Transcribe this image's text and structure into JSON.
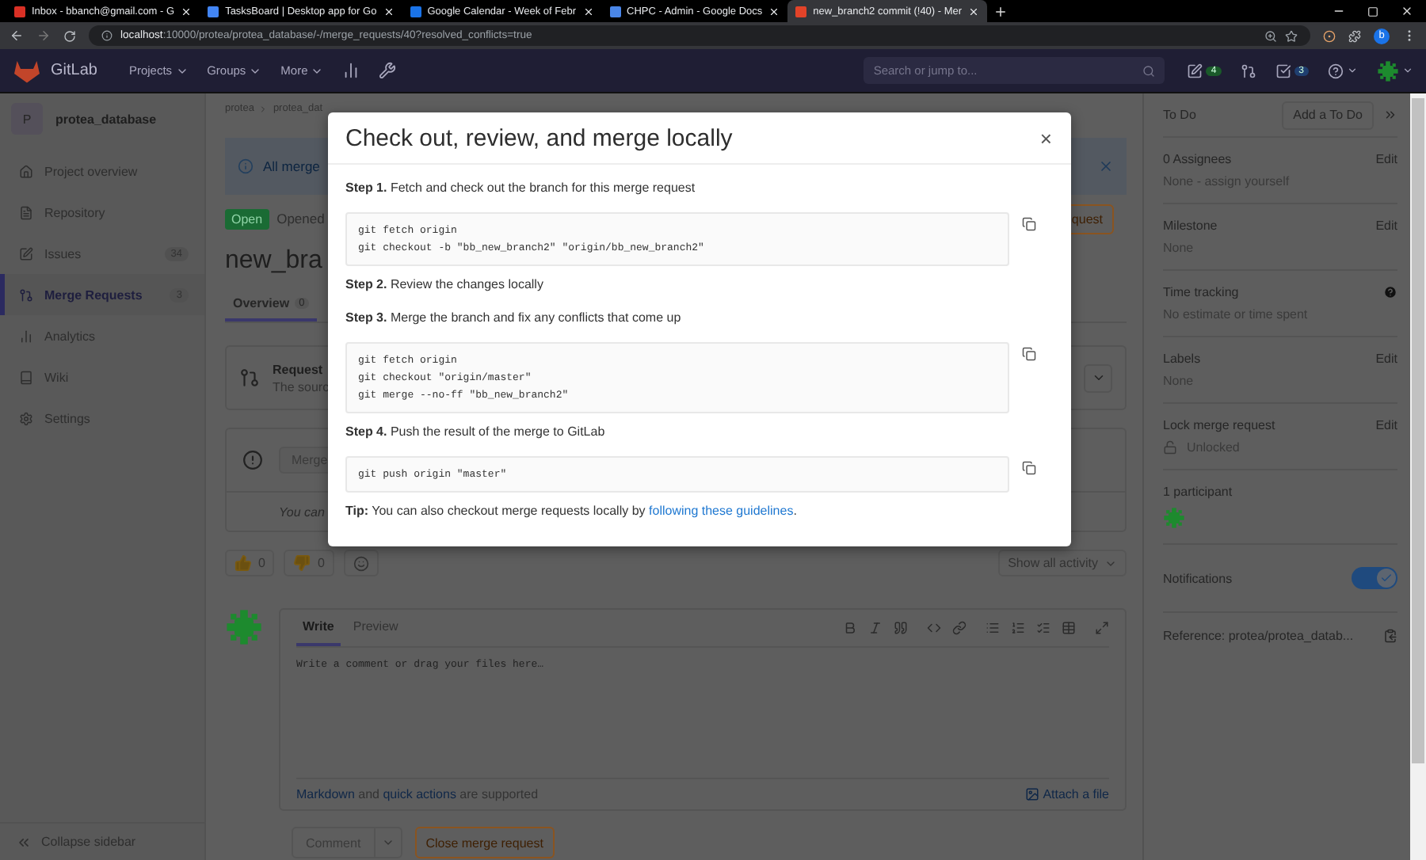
{
  "browser": {
    "tabs": [
      {
        "title": "Inbox - bbanch@gmail.com - G",
        "selected": false
      },
      {
        "title": "TasksBoard | Desktop app for Go",
        "selected": false
      },
      {
        "title": "Google Calendar - Week of Febr",
        "selected": false
      },
      {
        "title": "CHPC - Admin - Google Docs",
        "selected": false
      },
      {
        "title": "new_branch2 commit (!40) - Mer",
        "selected": true
      }
    ],
    "url_host": "localhost",
    "url_rest": ":10000/protea/protea_database/-/merge_requests/40?resolved_conflicts=true",
    "profile_initial": "b"
  },
  "navbar": {
    "brand": "GitLab",
    "menus": [
      "Projects",
      "Groups",
      "More"
    ],
    "search": {
      "placeholder": "Search or jump to..."
    },
    "issues_count": "4",
    "todos_count": "3"
  },
  "sidebar": {
    "project_initial": "P",
    "project_name": "protea_database",
    "items": [
      {
        "label": "Project overview",
        "selected": false
      },
      {
        "label": "Repository",
        "selected": false
      },
      {
        "label": "Issues",
        "count": "34",
        "selected": false
      },
      {
        "label": "Merge Requests",
        "count": "3",
        "selected": true
      },
      {
        "label": "Analytics",
        "selected": false
      },
      {
        "label": "Wiki",
        "selected": false
      },
      {
        "label": "Settings",
        "selected": false
      }
    ],
    "collapse": "Collapse sidebar"
  },
  "breadcrumb": [
    "protea",
    "protea_dat"
  ],
  "alert": {
    "text": "All merge"
  },
  "status": {
    "badge": "Open",
    "text": "Opened"
  },
  "header_button": "quest",
  "title": "new_bra",
  "tabs": [
    {
      "label": "Overview",
      "count": "0",
      "selected": true
    }
  ],
  "request_card": {
    "title": "Request",
    "text": "The sourc"
  },
  "merge_widget": {
    "button": "Merge",
    "note": "You can"
  },
  "reactions": [
    {
      "kind": "thumbs_up",
      "count": "0"
    },
    {
      "kind": "thumbs_down",
      "count": "0"
    }
  ],
  "activity_filter": "Show all activity",
  "editor": {
    "tabs": [
      {
        "label": "Write",
        "selected": true
      },
      {
        "label": "Preview",
        "selected": false
      }
    ],
    "placeholder": "Write a comment or drag your files here…",
    "footer": [
      {
        "text": "Markdown",
        "kind": "link"
      },
      {
        "text": " and ",
        "kind": "text"
      },
      {
        "text": "quick actions",
        "kind": "link"
      },
      {
        "text": " are supported",
        "kind": "text"
      }
    ],
    "attach": "Attach a file"
  },
  "actions": {
    "comment": "Comment",
    "close": "Close merge request"
  },
  "right_sidebar": {
    "todo_label": "To Do",
    "todo_button": "Add a To Do",
    "sections": [
      {
        "title": "0 Assignees",
        "action": "Edit",
        "value": "None - assign yourself"
      },
      {
        "title": "Milestone",
        "action": "Edit",
        "value": "None"
      },
      {
        "title": "Time tracking",
        "help": true,
        "value": "No estimate or time spent"
      },
      {
        "title": "Labels",
        "action": "Edit",
        "value": "None"
      },
      {
        "title": "Lock merge request",
        "action": "Edit",
        "value": "Unlocked",
        "lock": true
      },
      {
        "title": "1 participant",
        "avatar": true
      }
    ],
    "notifications": {
      "label": "Notifications",
      "on": true
    },
    "reference": "Reference: protea/protea_datab..."
  },
  "modal": {
    "title": "Check out, review, and merge locally",
    "close": "×",
    "steps": [
      {
        "text": "**Step 1.** Fetch and check out the branch for this merge request",
        "code": [
          "git fetch origin",
          "git checkout -b \"bb_new_branch2\" \"origin/bb_new_branch2\""
        ]
      },
      {
        "text": "**Step 2.** Review the changes locally"
      },
      {
        "text": "**Step 3.** Merge the branch and fix any conflicts that come up",
        "code": [
          "git fetch origin",
          "git checkout \"origin/master\"",
          "git merge --no-ff \"bb_new_branch2\""
        ]
      },
      {
        "text": "**Step 4.** Push the result of the merge to GitLab",
        "code": [
          "git push origin \"master\""
        ]
      }
    ],
    "tip": {
      "text": "**Tip:** You can also checkout merge requests locally by ",
      "link": "following these guidelines",
      "tail": "."
    }
  }
}
